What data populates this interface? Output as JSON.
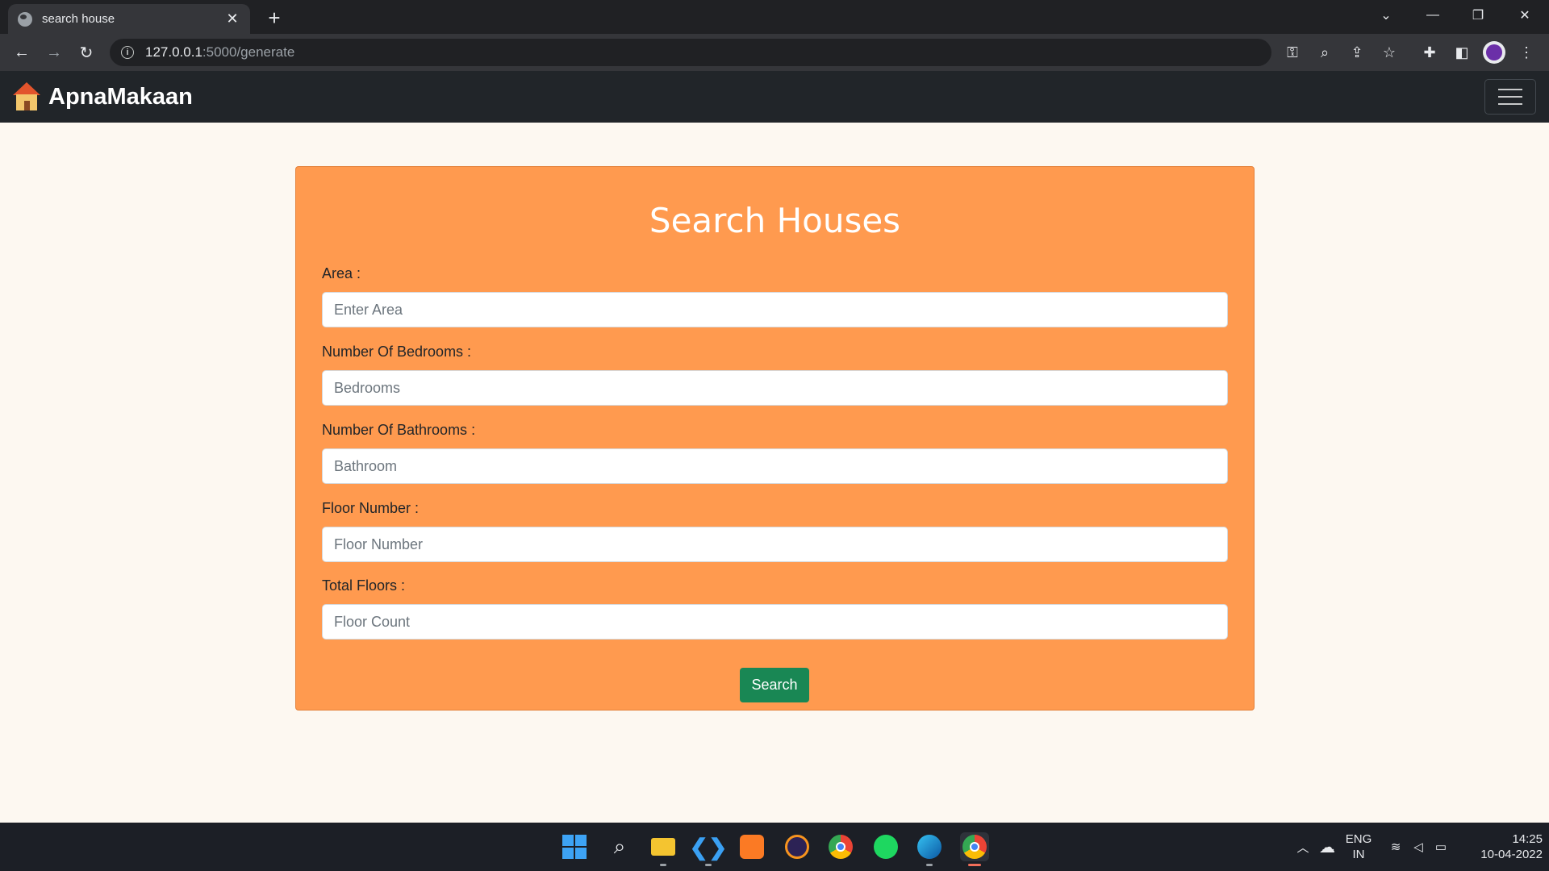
{
  "browser": {
    "tab_title": "search house",
    "tab_close": "✕",
    "new_tab": "+",
    "url_host": "127.0.0.1",
    "url_path": ":5000/generate"
  },
  "navbar": {
    "brand": "ApnaMakaan"
  },
  "form": {
    "title": "Search Houses",
    "fields": [
      {
        "label": "Area :",
        "placeholder": "Enter Area"
      },
      {
        "label": "Number Of Bedrooms :",
        "placeholder": "Bedrooms"
      },
      {
        "label": "Number Of Bathrooms :",
        "placeholder": "Bathroom"
      },
      {
        "label": "Floor Number :",
        "placeholder": "Floor Number"
      },
      {
        "label": "Total Floors :",
        "placeholder": "Floor Count"
      }
    ],
    "submit_label": "Search"
  },
  "taskbar": {
    "language": "ENG",
    "region": "IN",
    "time": "14:25",
    "date": "10-04-2022"
  },
  "colors": {
    "card_bg": "#ff9a4f",
    "navbar_bg": "#212529",
    "button_bg": "#198754",
    "page_bg": "#fdf8f1"
  }
}
